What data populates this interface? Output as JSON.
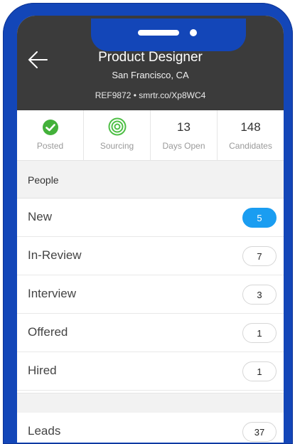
{
  "header": {
    "title": "Product Designer",
    "location": "San Francisco, CA",
    "reference": "REF9872 • smrtr.co/Xp8WC4"
  },
  "stats": [
    {
      "value": "",
      "label": "Posted",
      "icon": "check-circle-icon"
    },
    {
      "value": "",
      "label": "Sourcing",
      "icon": "target-icon"
    },
    {
      "value": "13",
      "label": "Days Open"
    },
    {
      "value": "148",
      "label": "Candidates"
    }
  ],
  "people": {
    "heading": "People",
    "rows": [
      {
        "label": "New",
        "count": "5"
      },
      {
        "label": "In-Review",
        "count": "7"
      },
      {
        "label": "Interview",
        "count": "3"
      },
      {
        "label": "Offered",
        "count": "1"
      },
      {
        "label": "Hired",
        "count": "1"
      }
    ]
  },
  "leads": {
    "label": "Leads",
    "count": "37"
  },
  "colors": {
    "frame": "#1346b8",
    "header_bg": "#3b3b3b",
    "accent_badge": "#1a9df1",
    "success": "#43b13a",
    "sourcing": "#4fbf46"
  }
}
